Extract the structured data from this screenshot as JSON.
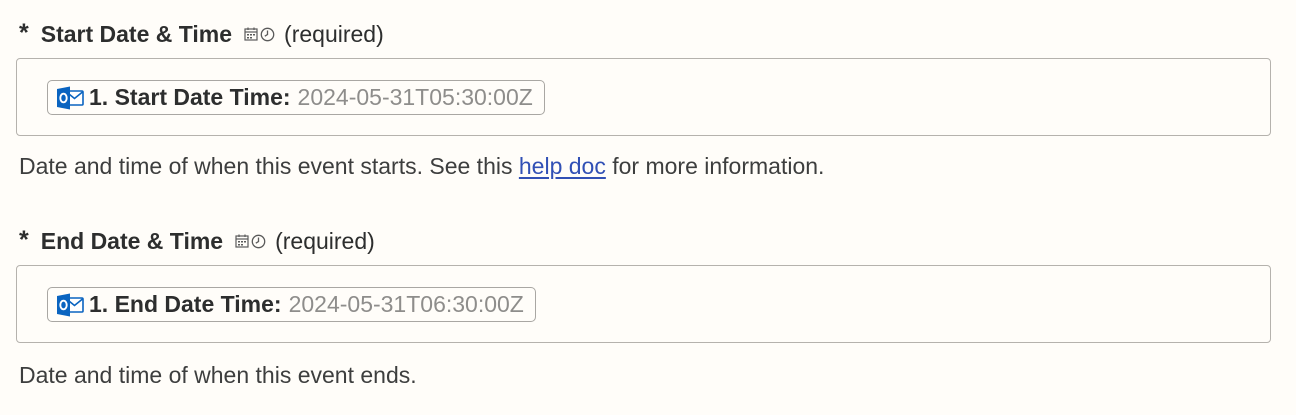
{
  "fields": [
    {
      "asterisk": "*",
      "label": "Start Date & Time",
      "type_icons": [
        "calendar-icon",
        "clock-icon"
      ],
      "required_text": "(required)",
      "pill": {
        "app_icon": "outlook-icon",
        "label": "1. Start Date Time:",
        "value": "2024-05-31T05:30:00Z"
      },
      "help": {
        "before": "Date and time of when this event starts. See this ",
        "link": "help doc",
        "after": " for more information."
      }
    },
    {
      "asterisk": "*",
      "label": "End Date & Time",
      "type_icons": [
        "calendar-icon",
        "clock-icon"
      ],
      "required_text": "(required)",
      "pill": {
        "app_icon": "outlook-icon",
        "label": "1. End Date Time:",
        "value": "2024-05-31T06:30:00Z"
      },
      "help": {
        "before": "Date and time of when this event ends.",
        "link": "",
        "after": ""
      }
    }
  ],
  "colors": {
    "background": "#fffdf9",
    "text": "#2d2e2e",
    "muted_value": "#8e8d8b",
    "link": "#3150b5",
    "border": "#b5b2ad",
    "outlook_blue": "#0a64c0"
  }
}
